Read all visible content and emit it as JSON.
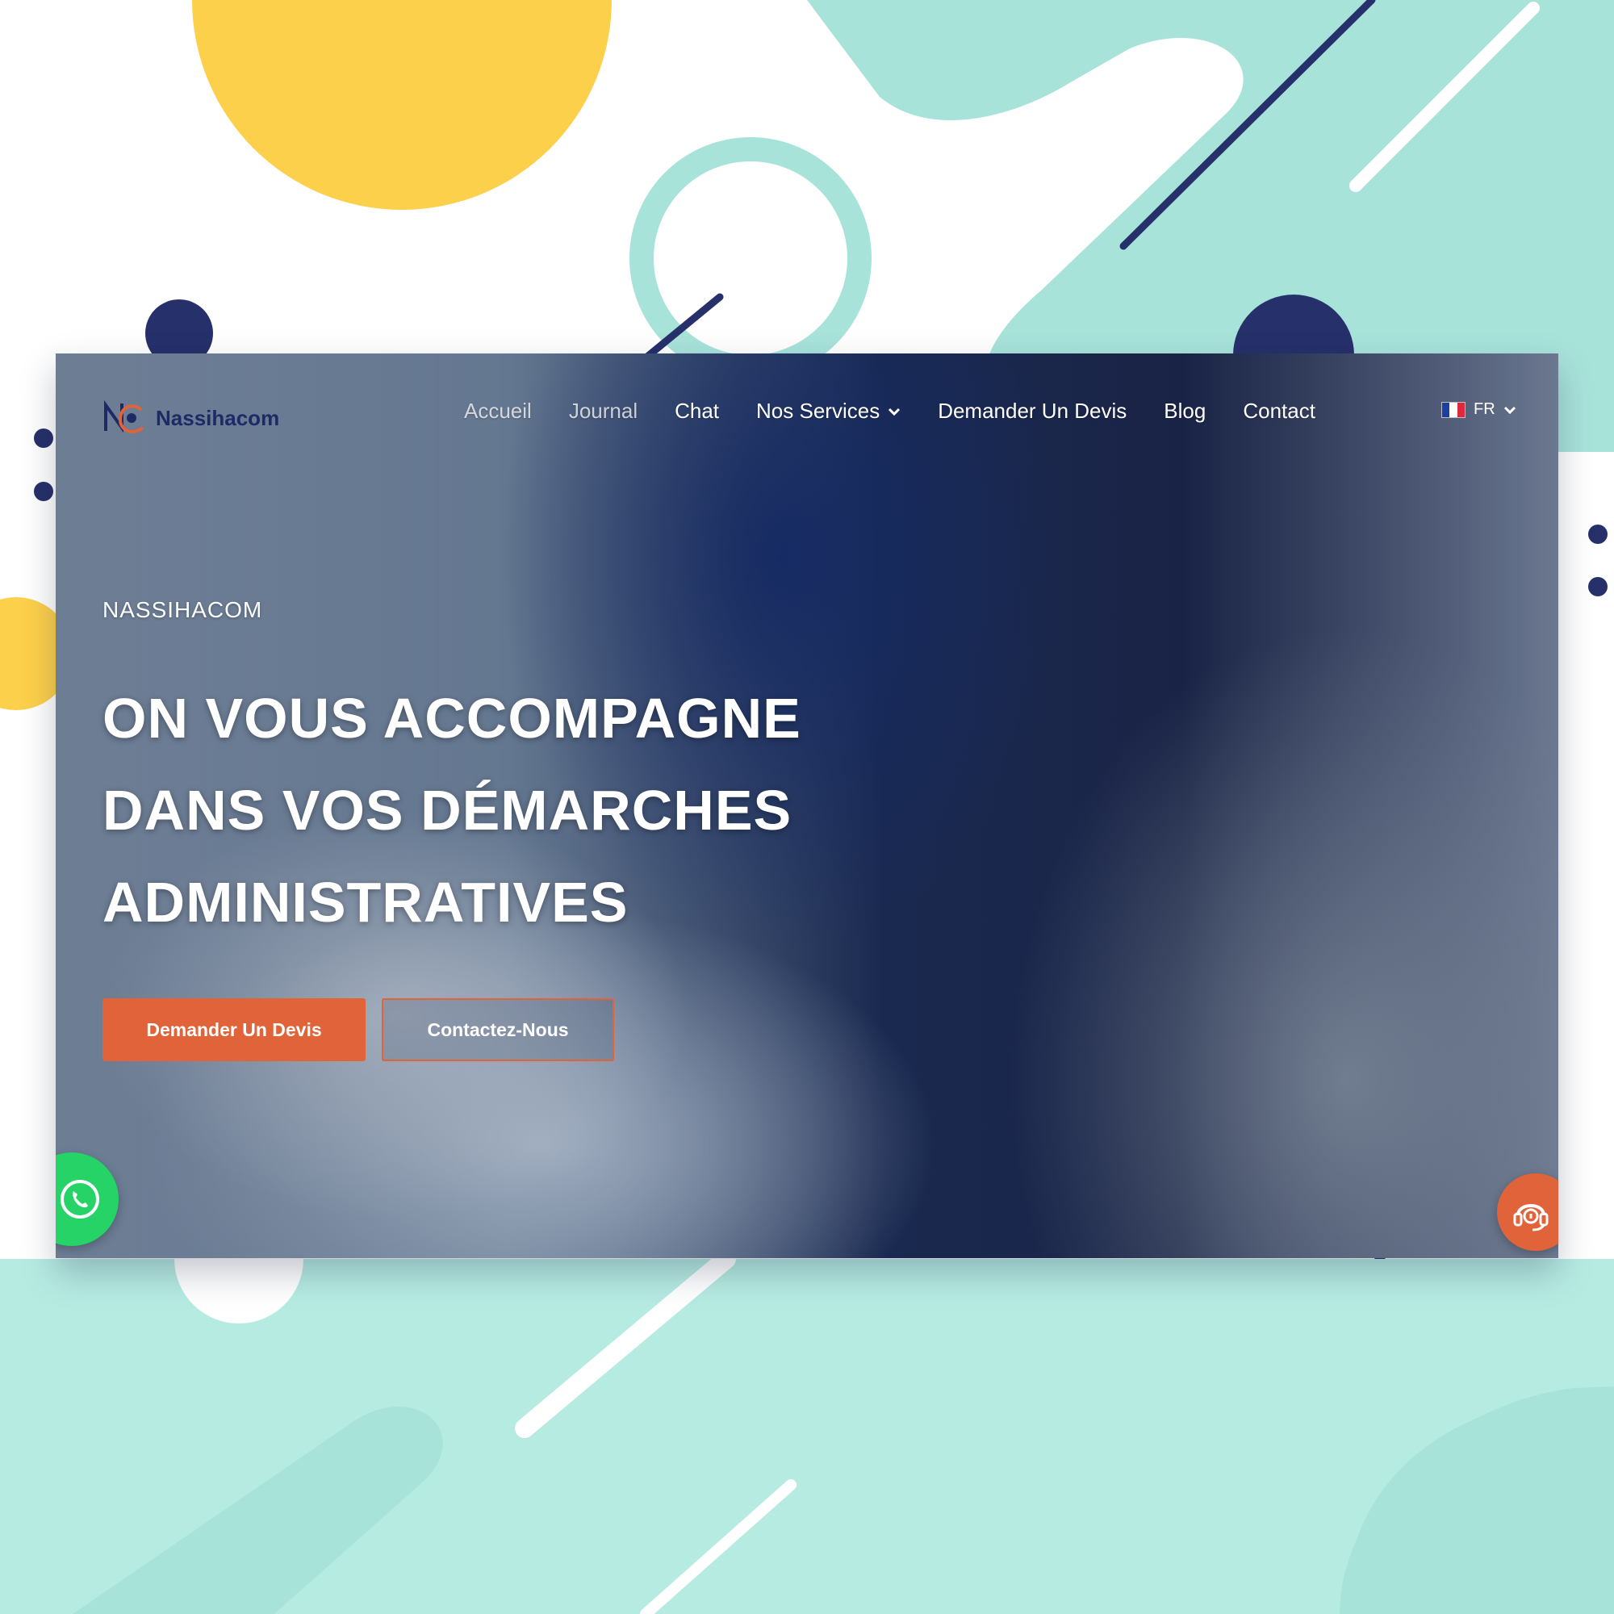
{
  "brand": {
    "logo_text": "Nassihacom",
    "colors": {
      "navy": "#1e2a66",
      "orange": "#e0633a",
      "teal": "#a8e3da",
      "yellow": "#fdd04b",
      "whatsapp": "#25d366"
    }
  },
  "nav": {
    "items": [
      {
        "label": "Accueil",
        "has_dropdown": false
      },
      {
        "label": "Journal",
        "has_dropdown": false
      },
      {
        "label": "Chat",
        "has_dropdown": false
      },
      {
        "label": "Nos Services",
        "has_dropdown": true
      },
      {
        "label": "Demander Un Devis",
        "has_dropdown": false
      },
      {
        "label": "Blog",
        "has_dropdown": false
      },
      {
        "label": "Contact",
        "has_dropdown": false
      }
    ],
    "language": {
      "label": "FR",
      "flag": "france-flag-icon"
    }
  },
  "hero": {
    "eyebrow": "NASSIHACOM",
    "headline": [
      "ON VOUS ACCOMPAGNE",
      "DANS VOS DÉMARCHES",
      "ADMINISTRATIVES"
    ],
    "primary_cta": "Demander Un Devis",
    "secondary_cta": "Contactez-Nous"
  },
  "widgets": {
    "whatsapp_icon": "whatsapp-icon",
    "support_icon": "headset-support-icon"
  }
}
